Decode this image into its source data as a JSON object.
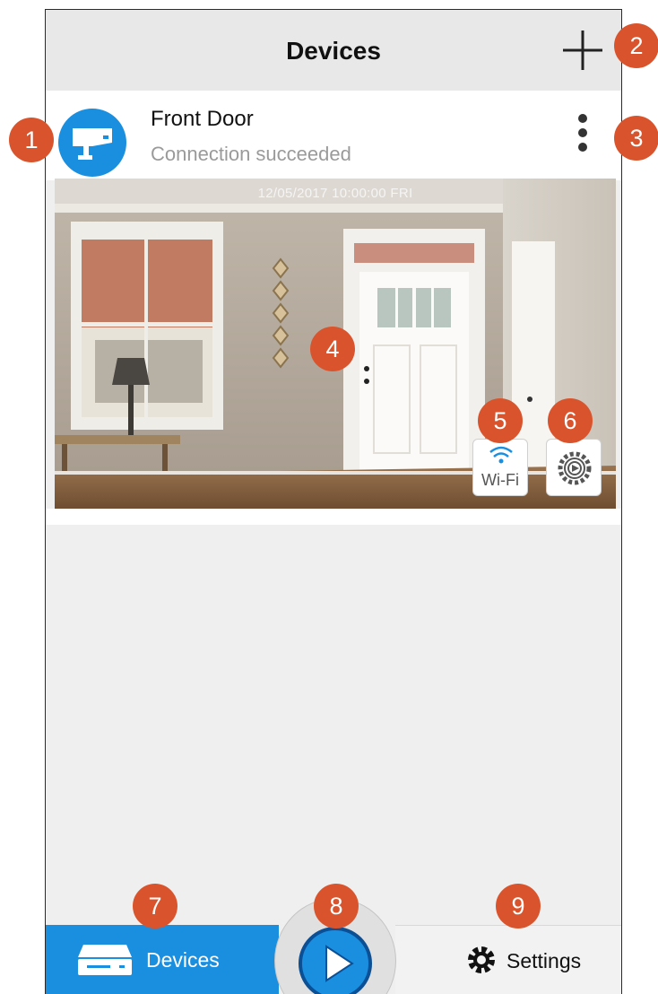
{
  "header": {
    "title": "Devices"
  },
  "device": {
    "name": "Front Door",
    "status": "Connection succeeded",
    "timestamp": "12/05/2017 10:00:00 FRI",
    "wifi_label": "Wi-Fi"
  },
  "tabs": {
    "devices_label": "Devices",
    "settings_label": "Settings"
  },
  "callouts": [
    "1",
    "2",
    "3",
    "4",
    "5",
    "6",
    "7",
    "8",
    "9"
  ],
  "icons": {
    "add": "plus-icon",
    "more": "more-vertical-icon",
    "camera": "security-camera-icon",
    "wifi": "wifi-icon",
    "gear": "gear-icon",
    "play": "play-icon",
    "dvr": "dvr-icon"
  },
  "colors": {
    "accent": "#1a8fe0",
    "callout": "#d9542c",
    "header_bg": "#e8e8e8",
    "page_bg": "#efefef"
  }
}
